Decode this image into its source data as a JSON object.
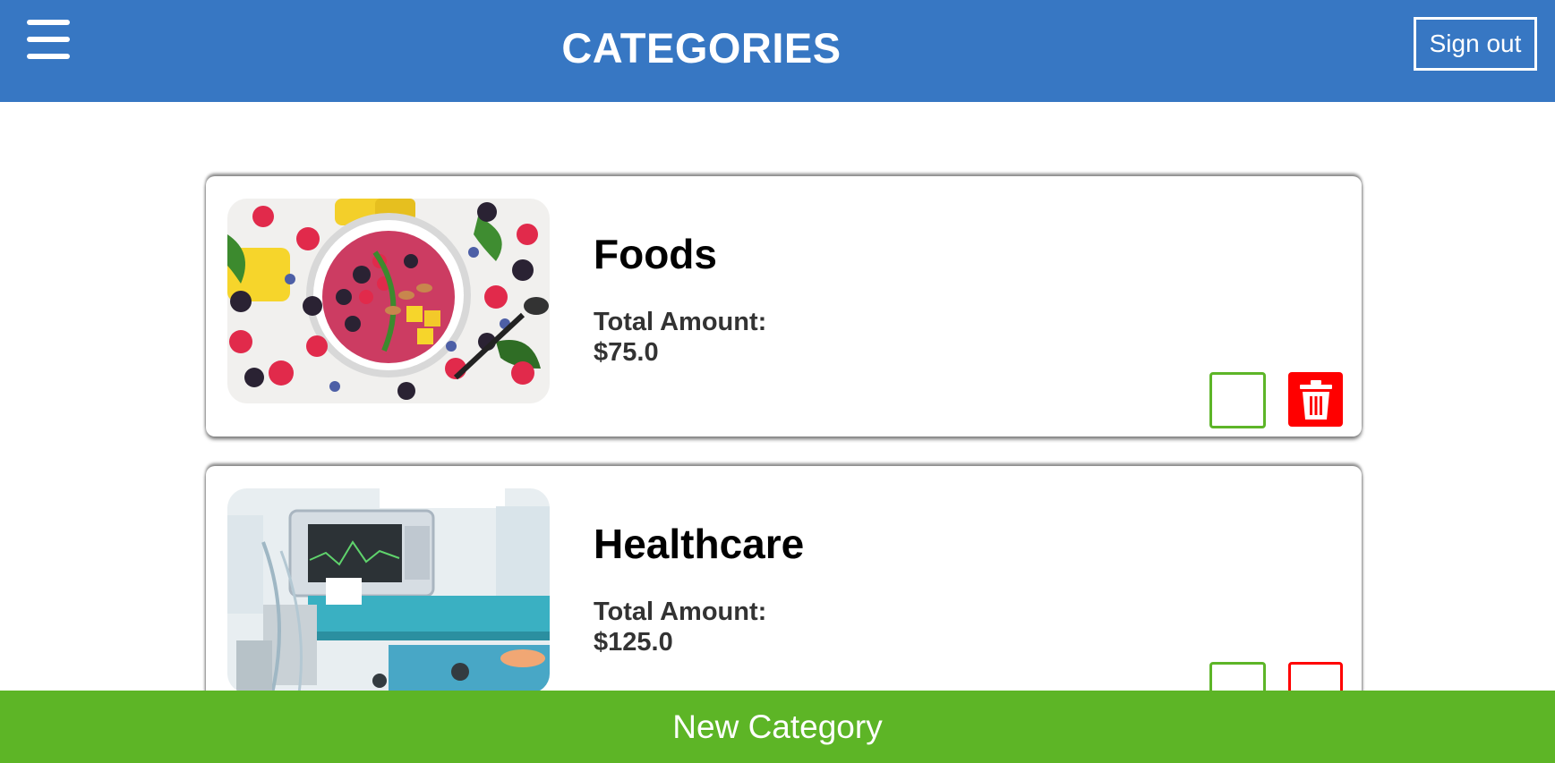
{
  "header": {
    "title": "CATEGORIES",
    "signout_label": "Sign out",
    "menu_icon": "hamburger-menu-icon",
    "background_color": "#3777c3"
  },
  "categories": [
    {
      "name": "Foods",
      "amount_label": "Total Amount:",
      "amount_value": "$75.0",
      "image": "fruit-bowl-photo"
    },
    {
      "name": "Healthcare",
      "amount_label": "Total Amount:",
      "amount_value": "$125.0",
      "image": "hospital-equipment-photo"
    }
  ],
  "actions": {
    "edit_color": "#5db528",
    "delete_color": "#ff0000",
    "delete_icon": "trash-icon"
  },
  "footer": {
    "new_category_label": "New Category",
    "background_color": "#5db526"
  }
}
